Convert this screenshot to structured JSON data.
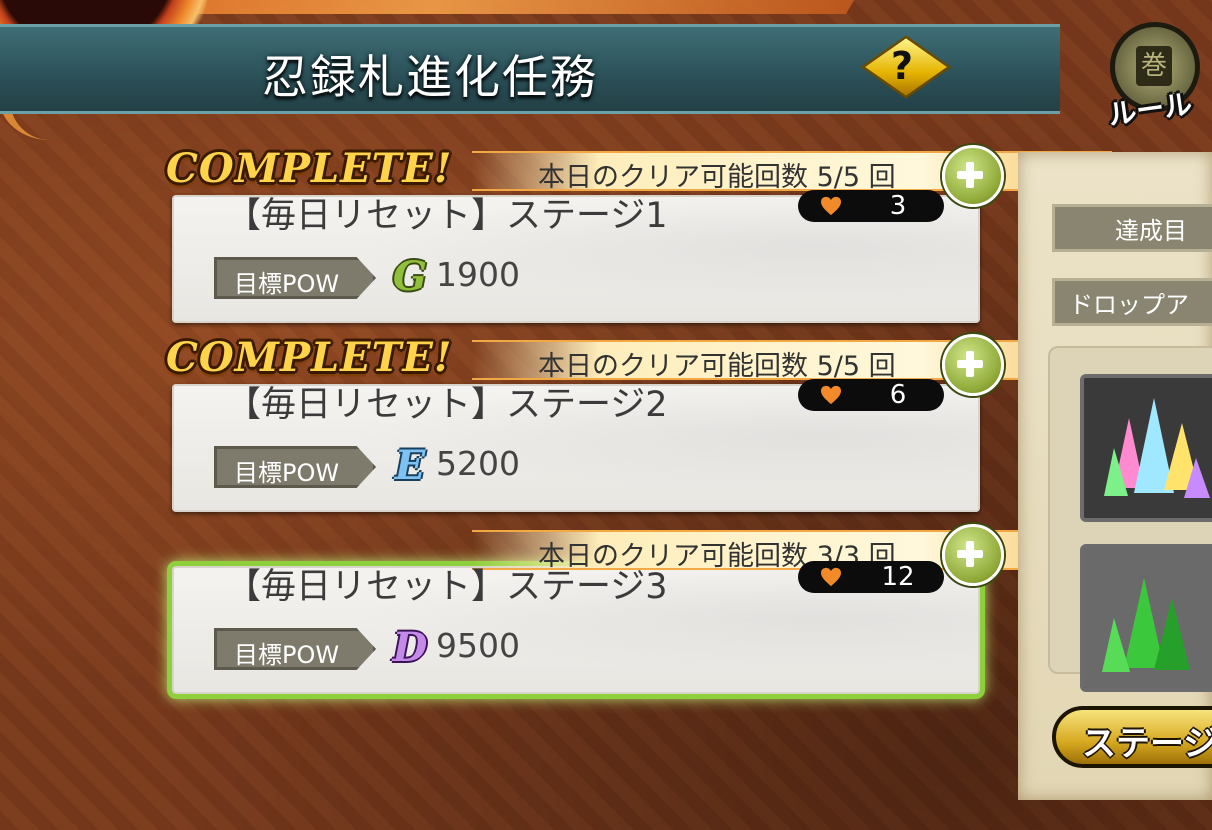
{
  "header": {
    "title": "忍録札進化任務",
    "help_label": "?",
    "rule_label": "ルール"
  },
  "missions": [
    {
      "complete_label": "COMPLETE!",
      "clear_count_text": "本日のクリア可能回数 5/5 回",
      "stage_name": "【毎日リセット】ステージ1",
      "hearts": "3",
      "pow_label": "目標POW",
      "rank": "G",
      "pow_value": "1900"
    },
    {
      "complete_label": "COMPLETE!",
      "clear_count_text": "本日のクリア可能回数 5/5 回",
      "stage_name": "【毎日リセット】ステージ2",
      "hearts": "6",
      "pow_label": "目標POW",
      "rank": "E",
      "pow_value": "5200"
    },
    {
      "complete_label": "",
      "clear_count_text": "本日のクリア可能回数 3/3 回",
      "stage_name": "【毎日リセット】ステージ3",
      "hearts": "12",
      "pow_label": "目標POW",
      "rank": "D",
      "pow_value": "9500"
    }
  ],
  "side_panel": {
    "target_label": "達成目",
    "drop_label": "ドロップア",
    "stage_button_label": "ステージ"
  },
  "colors": {
    "rank_G": "#8fbf3c",
    "rank_E": "#3f8fd6",
    "rank_D": "#9b4cc8",
    "selected_glow": "#8ecf3c"
  }
}
